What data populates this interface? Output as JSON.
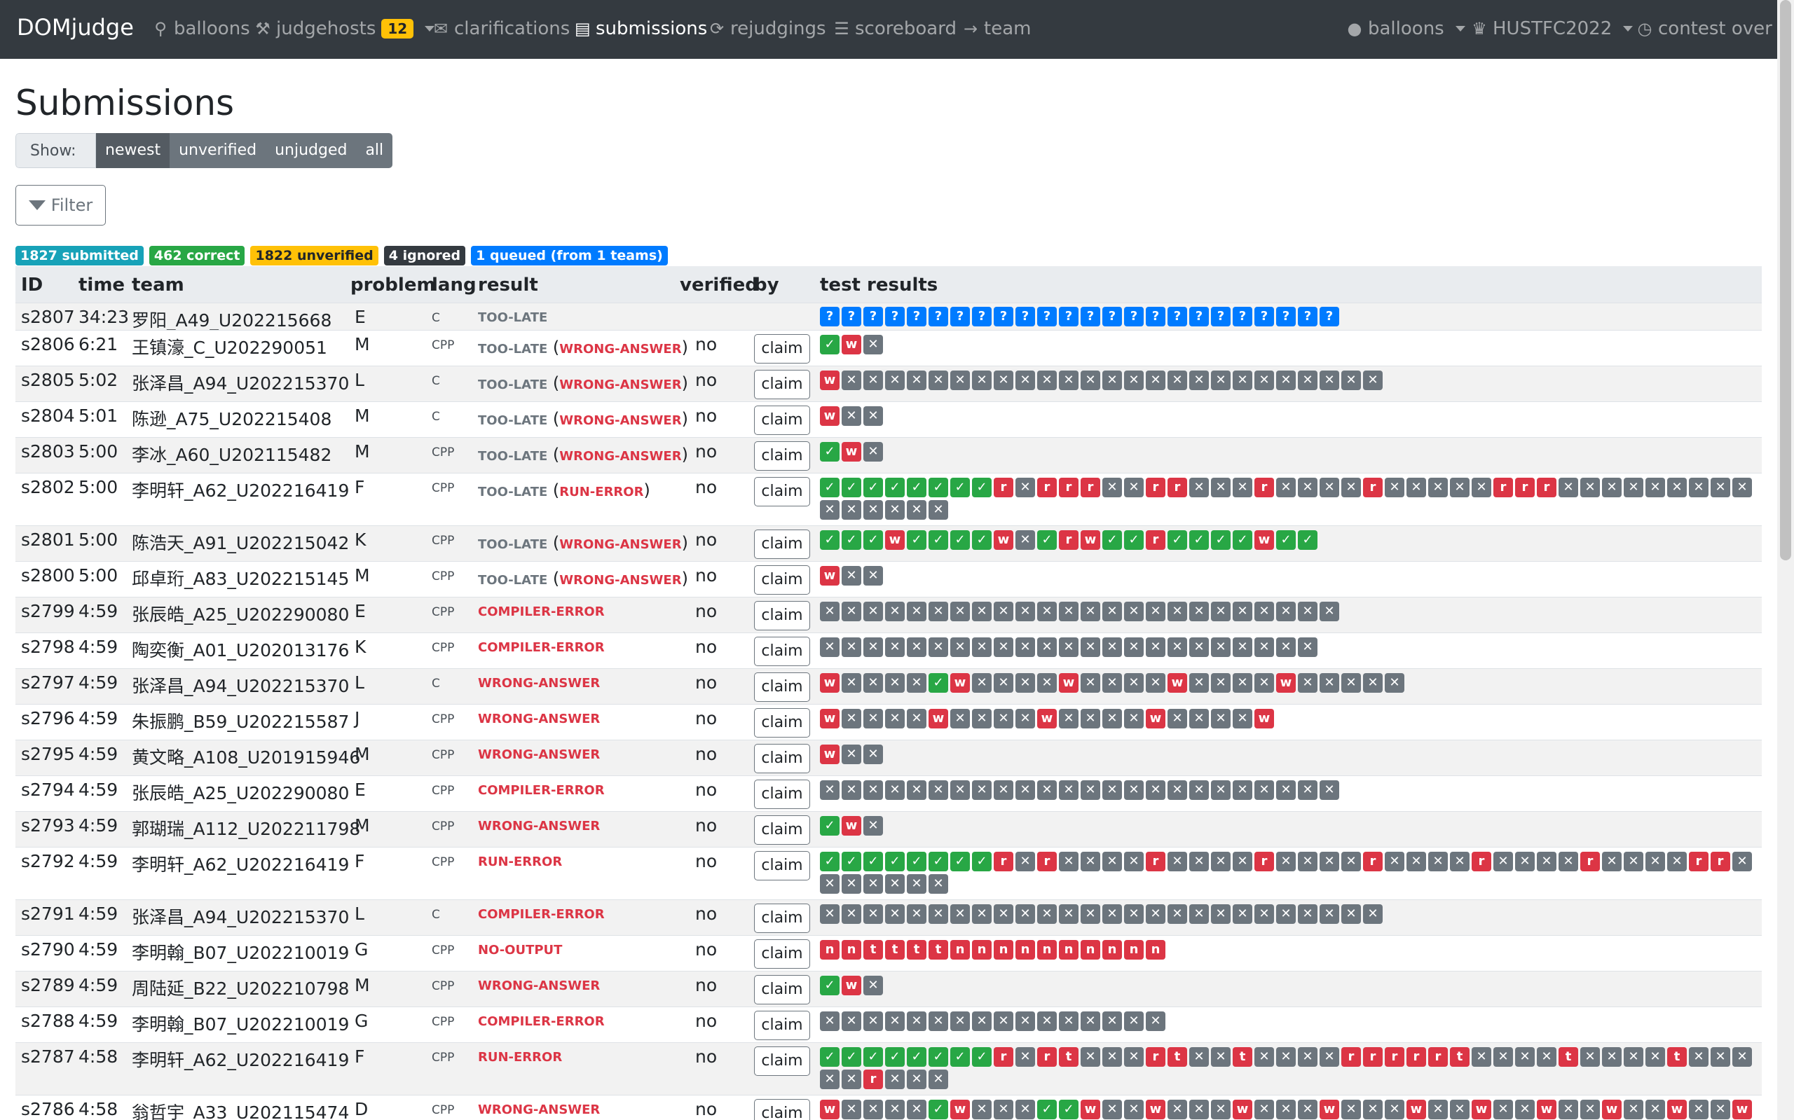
{
  "nav": {
    "brand": "DOMjudge",
    "items": [
      {
        "key": "balloons",
        "label": "balloons",
        "icon": "map-marker-icon",
        "glyph": "⚲"
      },
      {
        "key": "judgehosts",
        "label": "judgehosts",
        "icon": "gavel-icon",
        "glyph": "⚒",
        "badge": "12",
        "caret": true
      },
      {
        "key": "clarifications",
        "label": "clarifications",
        "icon": "comments-icon",
        "glyph": "✉"
      },
      {
        "key": "submissions",
        "label": "submissions",
        "icon": "file-code-icon",
        "glyph": "▤",
        "active": true
      },
      {
        "key": "rejudgings",
        "label": "rejudgings",
        "icon": "sync-icon",
        "glyph": "⟳"
      },
      {
        "key": "scoreboard",
        "label": "scoreboard",
        "icon": "list-ol-icon",
        "glyph": "☰"
      },
      {
        "key": "team",
        "label": "team",
        "icon": "arrow-right-icon",
        "glyph": "→"
      }
    ],
    "right": [
      {
        "key": "user",
        "label": "balloons",
        "icon": "user-icon",
        "glyph": "●",
        "caret": true
      },
      {
        "key": "contest",
        "label": "HUSTFC2022",
        "icon": "trophy-icon",
        "glyph": "♛",
        "caret": true
      },
      {
        "key": "status",
        "label": "contest over",
        "icon": "clock-icon",
        "glyph": "◷"
      }
    ]
  },
  "page_title": "Submissions",
  "show": {
    "label": "Show:",
    "options": [
      "newest",
      "unverified",
      "unjudged",
      "all"
    ],
    "active": "newest"
  },
  "filter_label": "Filter",
  "summary": [
    {
      "text": "1827 submitted",
      "color": "#17a2b8"
    },
    {
      "text": "462 correct",
      "color": "#28a745"
    },
    {
      "text": "1822 unverified",
      "color": "#ffc107",
      "dark": true
    },
    {
      "text": "4 ignored",
      "color": "#343a40"
    },
    {
      "text": "1 queued (from 1 teams)",
      "color": "#007bff"
    }
  ],
  "columns": [
    "ID",
    "time",
    "team",
    "problem",
    "lang",
    "result",
    "verified",
    "by",
    "test results"
  ],
  "claim_label": "claim",
  "rows": [
    {
      "id": "s2807",
      "time": "34:23",
      "team": "罗阳_A49_U202215668",
      "problem": "E",
      "lang": "C",
      "late": true,
      "result": "",
      "verified": "",
      "claim": false,
      "tests": "????????????????????????"
    },
    {
      "id": "s2806",
      "time": "6:21",
      "team": "王镇濠_C_U202290051",
      "problem": "M",
      "lang": "CPP",
      "late": true,
      "result": "WRONG-ANSWER",
      "verified": "no",
      "claim": true,
      "tests": "vwx"
    },
    {
      "id": "s2805",
      "time": "5:02",
      "team": "张泽昌_A94_U202215370",
      "problem": "L",
      "lang": "C",
      "late": true,
      "result": "WRONG-ANSWER",
      "verified": "no",
      "claim": true,
      "tests": "wxxxxxxxxxxxxxxxxxxxxxxxxx"
    },
    {
      "id": "s2804",
      "time": "5:01",
      "team": "陈逊_A75_U202215408",
      "problem": "M",
      "lang": "C",
      "late": true,
      "result": "WRONG-ANSWER",
      "verified": "no",
      "claim": true,
      "tests": "wxx"
    },
    {
      "id": "s2803",
      "time": "5:00",
      "team": "李冰_A60_U202115482",
      "problem": "M",
      "lang": "CPP",
      "late": true,
      "result": "WRONG-ANSWER",
      "verified": "no",
      "claim": true,
      "tests": "vwx"
    },
    {
      "id": "s2802",
      "time": "5:00",
      "team": "李明轩_A62_U202216419",
      "problem": "F",
      "lang": "CPP",
      "late": true,
      "result": "RUN-ERROR",
      "verified": "no",
      "claim": true,
      "tests": "vvvvvvvvrxrrrxxrrxxxrxxxxrxxxxxrrrxxxxxxxxxxxxxxx"
    },
    {
      "id": "s2801",
      "time": "5:00",
      "team": "陈浩天_A91_U202215042",
      "problem": "K",
      "lang": "CPP",
      "late": true,
      "result": "WRONG-ANSWER",
      "verified": "no",
      "claim": true,
      "tests": "vvvwvvvvwxvrwvvrvvvvwvv"
    },
    {
      "id": "s2800",
      "time": "5:00",
      "team": "邱卓珩_A83_U202215145",
      "problem": "M",
      "lang": "CPP",
      "late": true,
      "result": "WRONG-ANSWER",
      "verified": "no",
      "claim": true,
      "tests": "wxx"
    },
    {
      "id": "s2799",
      "time": "4:59",
      "team": "张辰皓_A25_U202290080",
      "problem": "E",
      "lang": "CPP",
      "late": false,
      "result": "COMPILER-ERROR",
      "verified": "no",
      "claim": true,
      "tests": "xxxxxxxxxxxxxxxxxxxxxxxx"
    },
    {
      "id": "s2798",
      "time": "4:59",
      "team": "陶奕衡_A01_U202013176",
      "problem": "K",
      "lang": "CPP",
      "late": false,
      "result": "COMPILER-ERROR",
      "verified": "no",
      "claim": true,
      "tests": "xxxxxxxxxxxxxxxxxxxxxxx"
    },
    {
      "id": "s2797",
      "time": "4:59",
      "team": "张泽昌_A94_U202215370",
      "problem": "L",
      "lang": "C",
      "late": false,
      "result": "WRONG-ANSWER",
      "verified": "no",
      "claim": true,
      "tests": "wxxxxvwxxxxwxxxxwxxxxwxxxxx"
    },
    {
      "id": "s2796",
      "time": "4:59",
      "team": "朱振鹏_B59_U202215587",
      "problem": "J",
      "lang": "CPP",
      "late": false,
      "result": "WRONG-ANSWER",
      "verified": "no",
      "claim": true,
      "tests": "wxxxxwxxxxwxxxxwxxxxw"
    },
    {
      "id": "s2795",
      "time": "4:59",
      "team": "黄文略_A108_U201915946",
      "problem": "M",
      "lang": "CPP",
      "late": false,
      "result": "WRONG-ANSWER",
      "verified": "no",
      "claim": true,
      "tests": "wxx"
    },
    {
      "id": "s2794",
      "time": "4:59",
      "team": "张辰皓_A25_U202290080",
      "problem": "E",
      "lang": "CPP",
      "late": false,
      "result": "COMPILER-ERROR",
      "verified": "no",
      "claim": true,
      "tests": "xxxxxxxxxxxxxxxxxxxxxxxx"
    },
    {
      "id": "s2793",
      "time": "4:59",
      "team": "郭瑚瑞_A112_U202211798",
      "problem": "M",
      "lang": "CPP",
      "late": false,
      "result": "WRONG-ANSWER",
      "verified": "no",
      "claim": true,
      "tests": "vwx"
    },
    {
      "id": "s2792",
      "time": "4:59",
      "team": "李明轩_A62_U202216419",
      "problem": "F",
      "lang": "CPP",
      "late": false,
      "result": "RUN-ERROR",
      "verified": "no",
      "claim": true,
      "tests": "vvvvvvvvrxrxxxxrxxxxrxxxxrxxxxrxxxxrxxxxrrxxxxxxx"
    },
    {
      "id": "s2791",
      "time": "4:59",
      "team": "张泽昌_A94_U202215370",
      "problem": "L",
      "lang": "C",
      "late": false,
      "result": "COMPILER-ERROR",
      "verified": "no",
      "claim": true,
      "tests": "xxxxxxxxxxxxxxxxxxxxxxxxxx"
    },
    {
      "id": "s2790",
      "time": "4:59",
      "team": "李明翰_B07_U202210019",
      "problem": "G",
      "lang": "CPP",
      "late": false,
      "result": "NO-OUTPUT",
      "verified": "no",
      "claim": true,
      "tests": "nnttttnnnnnnnnnn"
    },
    {
      "id": "s2789",
      "time": "4:59",
      "team": "周陆延_B22_U202210798",
      "problem": "M",
      "lang": "CPP",
      "late": false,
      "result": "WRONG-ANSWER",
      "verified": "no",
      "claim": true,
      "tests": "vwx"
    },
    {
      "id": "s2788",
      "time": "4:59",
      "team": "李明翰_B07_U202210019",
      "problem": "G",
      "lang": "CPP",
      "late": false,
      "result": "COMPILER-ERROR",
      "verified": "no",
      "claim": true,
      "tests": "xxxxxxxxxxxxxxxx"
    },
    {
      "id": "s2787",
      "time": "4:58",
      "team": "李明轩_A62_U202216419",
      "problem": "F",
      "lang": "CPP",
      "late": false,
      "result": "RUN-ERROR",
      "verified": "no",
      "claim": true,
      "tests": "vvvvvvvvrxrtxxxrtxxtxxxxrrrrrtxxxxtxxxxtxxxxxrxxx"
    },
    {
      "id": "s2786",
      "time": "4:58",
      "team": "翁哲宇_A33_U202115474",
      "problem": "D",
      "lang": "CPP",
      "late": false,
      "result": "WRONG-ANSWER",
      "verified": "no",
      "claim": true,
      "tests": "wxxxxvwxxxvvwxxwxxxwxxxwxxxwxxwxxwxxwxxwxxwxxw"
    }
  ],
  "late_label": "TOO-LATE"
}
